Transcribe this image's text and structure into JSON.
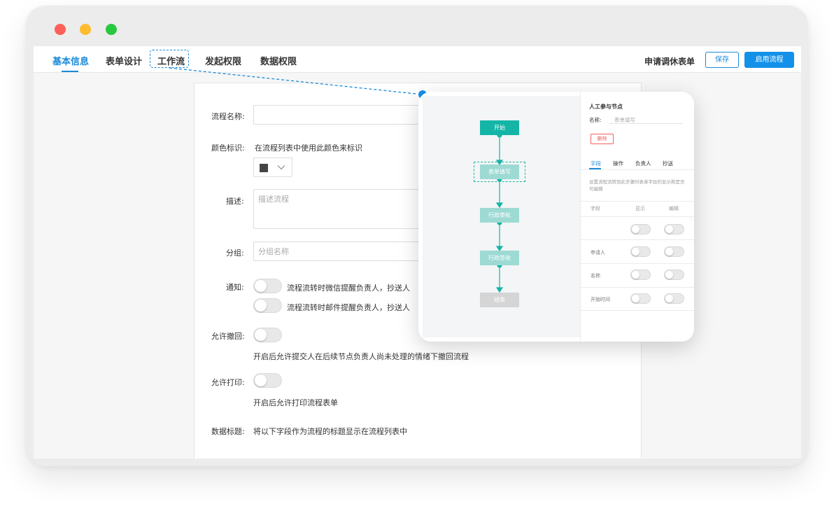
{
  "window": {
    "controls": [
      "close",
      "minimize",
      "maximize"
    ]
  },
  "topnav": {
    "tabs": [
      {
        "label": "基本信息",
        "active": true
      },
      {
        "label": "表单设计",
        "active": false
      },
      {
        "label": "工作流",
        "active": false,
        "highlighted": true
      },
      {
        "label": "发起权限",
        "active": false
      },
      {
        "label": "数据权限",
        "active": false
      }
    ],
    "form_title": "申请调休表单",
    "save_label": "保存",
    "enable_label": "启用流程"
  },
  "form": {
    "name_label": "流程名称:",
    "color_label": "颜色标识:",
    "color_hint": "在流程列表中使用此颜色来标识",
    "color_value": "#444444",
    "desc_label": "描述:",
    "desc_placeholder": "描述流程",
    "group_label": "分组:",
    "group_placeholder": "分组名称",
    "notify_label": "通知:",
    "notify_wechat": "流程流转时微信提醒负责人，抄送人",
    "notify_email": "流程流转时邮件提醒负责人，抄送人",
    "withdraw_label": "允许撤回:",
    "withdraw_hint": "开启后允许提交人在后续节点负责人尚未处理的情绪下撤回流程",
    "print_label": "允许打印:",
    "print_hint": "开启后允许打印流程表单",
    "data_title_label": "数据标题:",
    "data_title_hint": "将以下字段作为流程的标题显示在流程列表中"
  },
  "popup": {
    "flow_nodes": [
      {
        "label": "开始",
        "kind": "start"
      },
      {
        "label": "表单填写",
        "kind": "mid",
        "selected": true
      },
      {
        "label": "行政审批",
        "kind": "mid"
      },
      {
        "label": "行政签收",
        "kind": "mid"
      },
      {
        "label": "结束",
        "kind": "end"
      }
    ],
    "side": {
      "title": "人工参与节点",
      "name_label": "名称:",
      "name_value": "表单填写",
      "delete_label": "删除",
      "tabs": [
        "字段",
        "操作",
        "负责人",
        "抄送"
      ],
      "active_tab": "字段",
      "desc": "设置流程流转到此步骤时表单字段的显示和是否可编辑",
      "headers": [
        "字段",
        "显示",
        "编辑"
      ],
      "rows": [
        "",
        "申请人",
        "名称",
        "开始时间"
      ]
    },
    "colors": {
      "accent": "#14b5a6",
      "accent_light": "#9ddad4",
      "end": "#d5d5d5"
    }
  },
  "colors": {
    "brand": "#1b8ad8",
    "primary_button": "#1391e8"
  }
}
